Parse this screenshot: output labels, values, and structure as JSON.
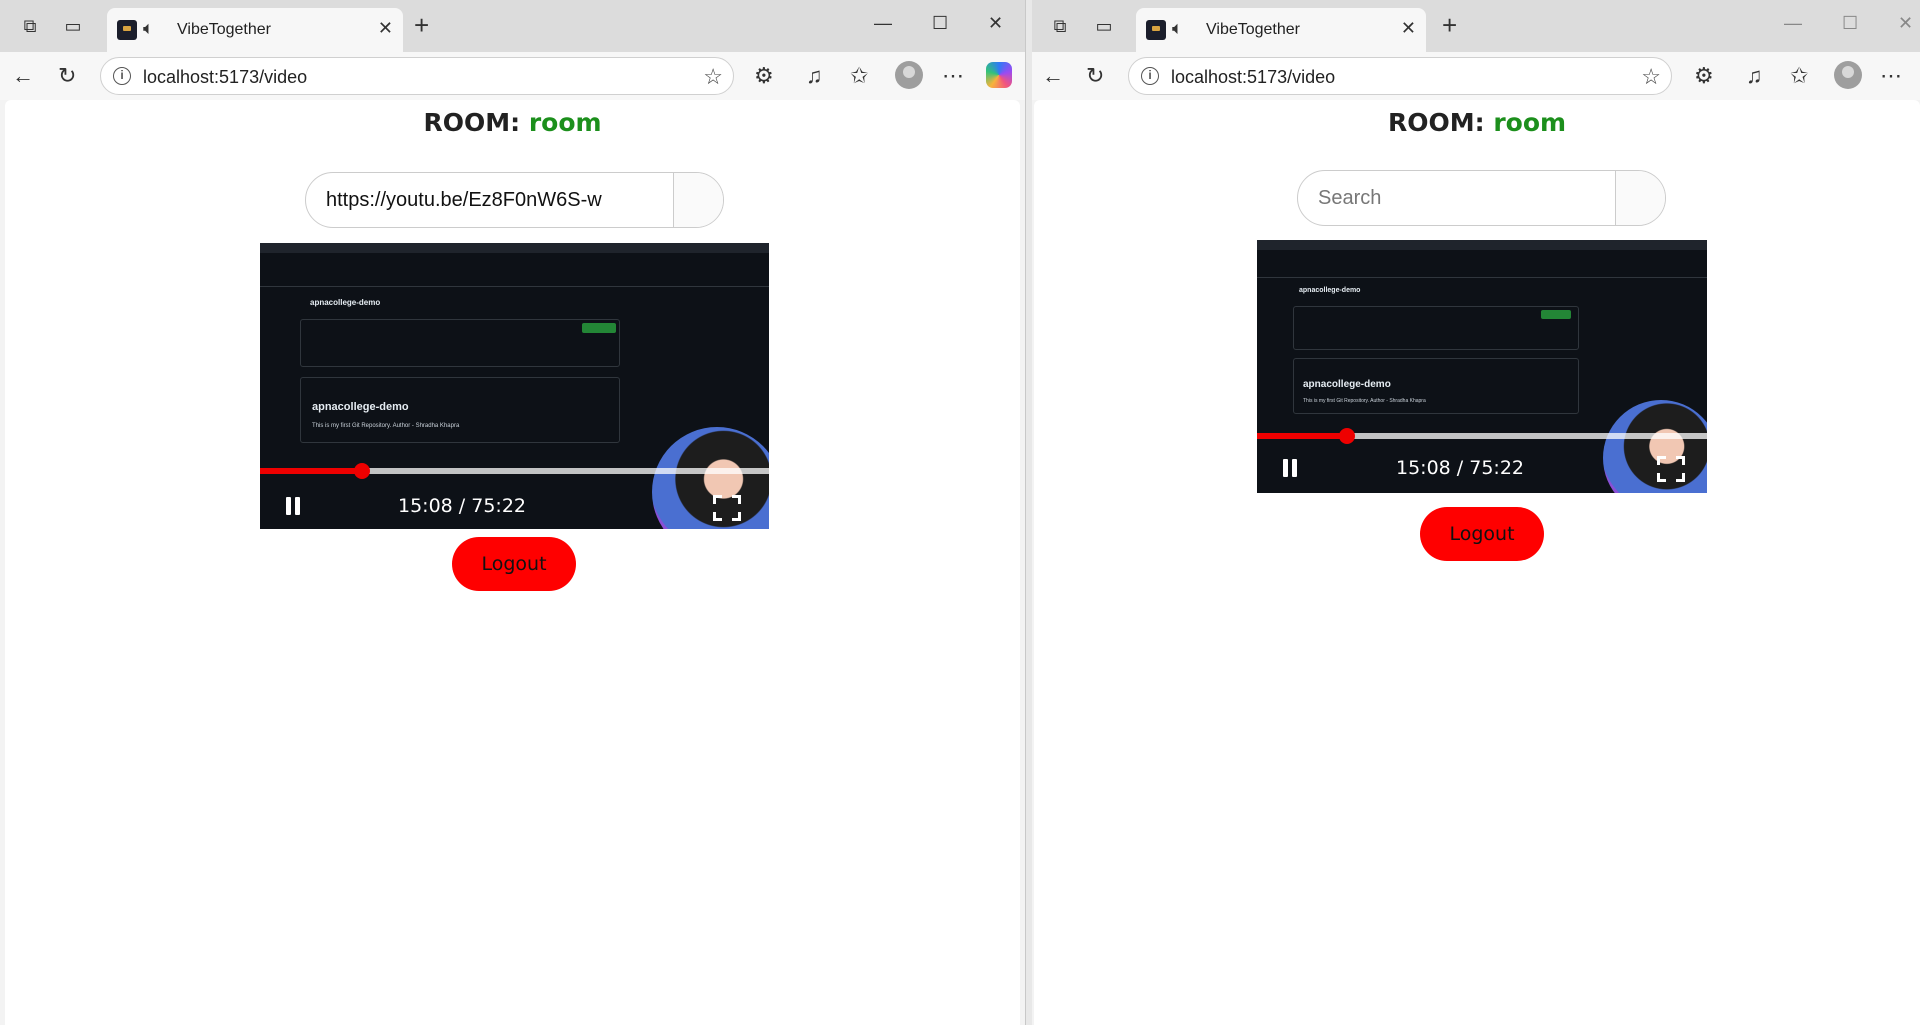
{
  "left": {
    "tab": {
      "title": "VibeTogether",
      "audio_icon": "speaker-icon"
    },
    "address": {
      "url": "localhost:5173/video"
    },
    "page": {
      "room_label": "ROOM:",
      "room_name": "room",
      "search": {
        "value": "https://youtu.be/Ez8F0nW6S-w",
        "placeholder": "Search"
      },
      "player": {
        "repo_name": "apnacollege-demo",
        "readme_heading": "apnacollege-demo",
        "readme_text": "This is my first Git Repository. Author - Shradha Khapra",
        "time": "15:08 / 75:22",
        "progress": 0.2
      },
      "logout_label": "Logout"
    }
  },
  "right": {
    "tab": {
      "title": "VibeTogether",
      "audio_icon": "speaker-icon"
    },
    "address": {
      "url": "localhost:5173/video"
    },
    "page": {
      "room_label": "ROOM:",
      "room_name": "room",
      "search": {
        "value": "",
        "placeholder": "Search"
      },
      "player": {
        "repo_name": "apnacollege-demo",
        "readme_heading": "apnacollege-demo",
        "readme_text": "This is my first Git Repository. Author - Shradha Khapra",
        "time": "15:08 / 75:22",
        "progress": 0.2
      },
      "logout_label": "Logout"
    }
  },
  "colors": {
    "room_name": "#1c8f1c",
    "logout_bg": "#ff0000",
    "progress": "#ee0000"
  }
}
